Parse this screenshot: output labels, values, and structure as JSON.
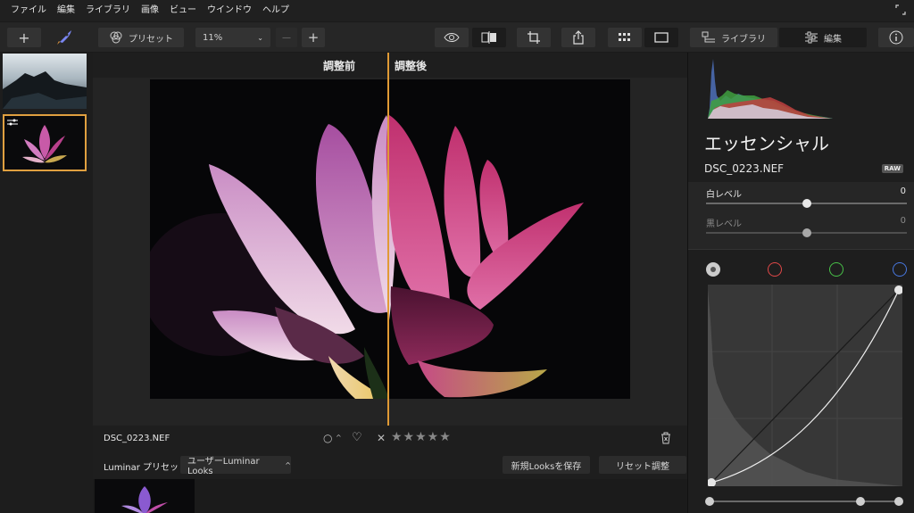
{
  "menu": [
    "ファイル",
    "編集",
    "ライブラリ",
    "画像",
    "ビュー",
    "ウインドウ",
    "ヘルプ"
  ],
  "window_icon": "resize-icon",
  "toolbar": {
    "add_symbol": "+",
    "preset_label": "プリセット",
    "zoom_value": "11%",
    "zoom_out_symbol": "—",
    "zoom_in_symbol": "+",
    "library_label": "ライブラリ",
    "edit_label": "編集"
  },
  "compare": {
    "before": "調整前",
    "after": "調整後"
  },
  "infobar": {
    "file_name": "DSC_0223.NEF",
    "flag_symbol": "○",
    "caret_symbol": "^",
    "heart_symbol": "♡",
    "reject_symbol": "✕",
    "stars": "★★★★★"
  },
  "presets_bar": {
    "label": "Luminar プリセット",
    "category": "ユーザーLuminar Looks",
    "save_button": "新規Looksを保存",
    "reset_button": "リセット調整"
  },
  "panel": {
    "title": "エッセンシャル",
    "file_name": "DSC_0223.NEF",
    "badge": "RAW",
    "sliders": [
      {
        "label": "白レベル",
        "value": "0"
      },
      {
        "label": "黒レベル",
        "value": "0"
      }
    ],
    "channels": [
      {
        "name": "luminosity",
        "color": "#cccccc"
      },
      {
        "name": "red",
        "color": "#e04848"
      },
      {
        "name": "green",
        "color": "#48c048"
      },
      {
        "name": "blue",
        "color": "#4878e0"
      }
    ]
  }
}
